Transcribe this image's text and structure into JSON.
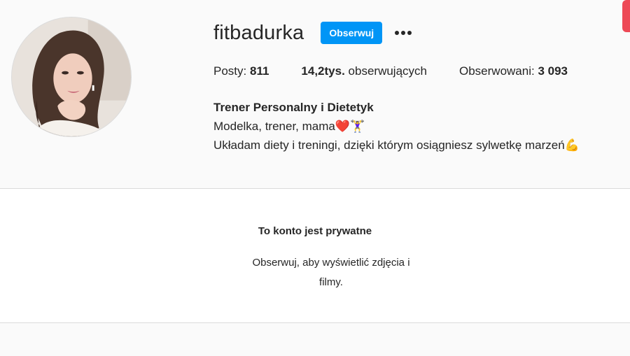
{
  "profile": {
    "username": "fitbadurka",
    "follow_label": "Obserwuj",
    "more_icon": "more-horizontal-icon"
  },
  "stats": {
    "posts_label": "Posty:",
    "posts_value": "811",
    "followers_value": "14,2tys.",
    "followers_label": "obserwujących",
    "following_label": "Obserwowani:",
    "following_value": "3 093"
  },
  "bio": {
    "name": "Trener Personalny i Dietetyk",
    "line1": "Modelka, trener, mama❤️🏋️‍♀️",
    "line2": "Układam diety i treningi, dzięki którym osiągniesz sylwetkę marzeń💪"
  },
  "private_notice": {
    "title": "To konto jest prywatne",
    "text": "Obserwuj, aby wyświetlić zdjęcia i filmy."
  },
  "colors": {
    "accent": "#0095f6",
    "background": "#fafafa",
    "corner_badge": "#ed4956"
  }
}
